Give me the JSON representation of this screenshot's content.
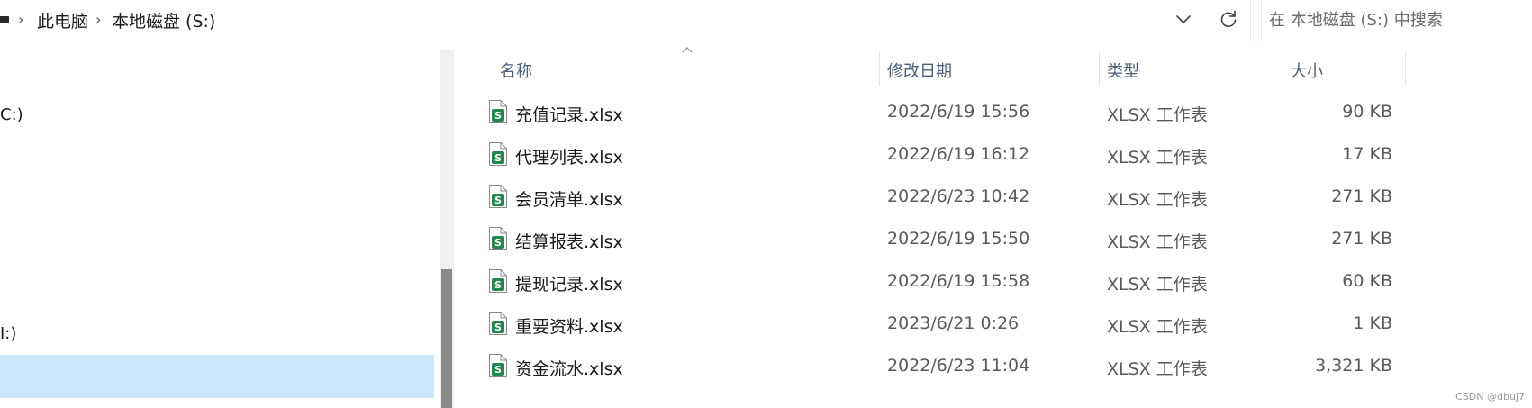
{
  "address": {
    "crumbs": [
      "此电脑",
      "本地磁盘 (S:)"
    ]
  },
  "search": {
    "placeholder": "在 本地磁盘 (S:) 中搜索"
  },
  "nav": {
    "items": [
      {
        "label": "C:)"
      },
      {
        "label": "I:)"
      }
    ]
  },
  "list": {
    "columns": {
      "name": "名称",
      "date": "修改日期",
      "type": "类型",
      "size": "大小"
    },
    "rows": [
      {
        "name": "充值记录.xlsx",
        "date": "2022/6/19 15:56",
        "type": "XLSX 工作表",
        "size": "90 KB"
      },
      {
        "name": "代理列表.xlsx",
        "date": "2022/6/19 16:12",
        "type": "XLSX 工作表",
        "size": "17 KB"
      },
      {
        "name": "会员清单.xlsx",
        "date": "2022/6/23 10:42",
        "type": "XLSX 工作表",
        "size": "271 KB"
      },
      {
        "name": "结算报表.xlsx",
        "date": "2022/6/19 15:50",
        "type": "XLSX 工作表",
        "size": "271 KB"
      },
      {
        "name": "提现记录.xlsx",
        "date": "2022/6/19 15:58",
        "type": "XLSX 工作表",
        "size": "60 KB"
      },
      {
        "name": "重要资料.xlsx",
        "date": "2023/6/21 0:26",
        "type": "XLSX 工作表",
        "size": "1 KB"
      },
      {
        "name": "资金流水.xlsx",
        "date": "2022/6/23 11:04",
        "type": "XLSX 工作表",
        "size": "3,321 KB"
      }
    ]
  },
  "icons": {
    "file": "spreadsheet-file-icon",
    "refresh": "refresh-icon",
    "dropdown": "chevron-down-icon",
    "sort": "sort-up-icon"
  },
  "colors": {
    "selection": "#cce8ff",
    "header_text": "#4c607a",
    "excel_green": "#1f8a4c"
  },
  "watermark": "CSDN @dbuj7"
}
